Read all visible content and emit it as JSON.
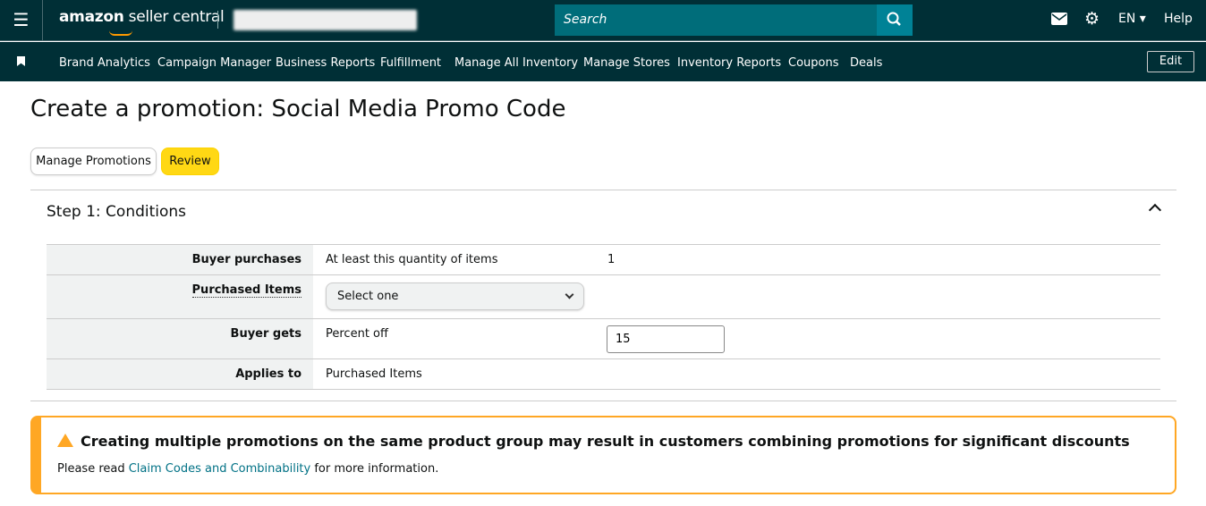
{
  "header": {
    "logo_brand": "amazon",
    "logo_product": "seller central",
    "search_placeholder": "Search",
    "language": "EN",
    "help": "Help"
  },
  "nav": {
    "items": [
      "Brand Analytics",
      "Campaign Manager",
      "Business Reports",
      "Fulfillment",
      "Manage All Inventory",
      "Manage Stores",
      "Inventory Reports",
      "Coupons",
      "Deals"
    ],
    "edit": "Edit"
  },
  "page": {
    "title": "Create a promotion: Social Media Promo Code",
    "manage_button": "Manage Promotions",
    "review_button": "Review"
  },
  "step": {
    "title": "Step 1: Conditions",
    "rows": {
      "buyer_purchases": {
        "label": "Buyer purchases",
        "value": "At least this quantity of items",
        "qty": "1"
      },
      "purchased_items": {
        "label": "Purchased Items",
        "select": "Select one"
      },
      "buyer_gets": {
        "label": "Buyer gets",
        "value": "Percent off",
        "amount": "15"
      },
      "applies_to": {
        "label": "Applies to",
        "value": "Purchased Items"
      }
    }
  },
  "alert": {
    "title": "Creating multiple promotions on the same product group may result in customers combining promotions for significant discounts",
    "pre": "Please read ",
    "link": "Claim Codes and Combinability",
    "post": " for more information."
  }
}
